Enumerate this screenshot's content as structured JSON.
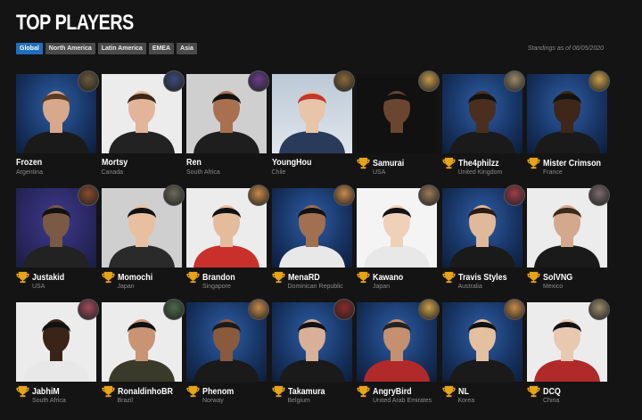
{
  "title": "TOP PLAYERS",
  "tabs": [
    "Global",
    "North America",
    "Latin America",
    "EMEA",
    "Asia"
  ],
  "active_tab": "Global",
  "standings": "Standings as of 06/05/2020",
  "colors": {
    "accent": "#1f6fbd",
    "background": "#141414",
    "trophy": "#e8a317",
    "muted": "#8a8a8a"
  },
  "players": [
    {
      "name": "Frozen",
      "country": "Argentina",
      "trophy": false,
      "bg": "bg-blue",
      "icon": "character-icon",
      "iconColor": "#6b5a3a"
    },
    {
      "name": "Mortsy",
      "country": "Canada",
      "trophy": false,
      "bg": "bg-white",
      "icon": "character-icon",
      "iconColor": "#3b4a7a"
    },
    {
      "name": "Ren",
      "country": "South Africa",
      "trophy": false,
      "bg": "bg-gray",
      "icon": "character-icon",
      "iconColor": "#6a3d8a"
    },
    {
      "name": "YoungHou",
      "country": "Chile",
      "trophy": false,
      "bg": "bg-sky",
      "icon": "character-icon",
      "iconColor": "#8a6a3a"
    },
    {
      "name": "Samurai",
      "country": "USA",
      "trophy": true,
      "bg": "bg-dark",
      "icon": "character-icon",
      "iconColor": "#c49a4a"
    },
    {
      "name": "The4philzz",
      "country": "United Kingdom",
      "trophy": true,
      "bg": "bg-blue",
      "icon": "character-icon",
      "iconColor": "#9a8a6a"
    },
    {
      "name": "Mister Crimson",
      "country": "France",
      "trophy": true,
      "bg": "bg-blue",
      "icon": "character-icon",
      "iconColor": "#c9a04a"
    },
    {
      "name": "Justakid",
      "country": "USA",
      "trophy": true,
      "bg": "bg-purple",
      "icon": "character-icon",
      "iconColor": "#8a4a2a"
    },
    {
      "name": "Momochi",
      "country": "Japan",
      "trophy": true,
      "bg": "bg-gray",
      "icon": "character-icon",
      "iconColor": "#6a6a5a"
    },
    {
      "name": "Brandon",
      "country": "Singapore",
      "trophy": true,
      "bg": "bg-white",
      "icon": "character-icon",
      "iconColor": "#c98a4a"
    },
    {
      "name": "MenaRD",
      "country": "Dominican Republic",
      "trophy": true,
      "bg": "bg-blue",
      "icon": "character-icon",
      "iconColor": "#c98a4a"
    },
    {
      "name": "Kawano",
      "country": "Japan",
      "trophy": true,
      "bg": "bg-light",
      "icon": "character-icon",
      "iconColor": "#9a7a5a"
    },
    {
      "name": "Travis Styles",
      "country": "Australia",
      "trophy": true,
      "bg": "bg-blue",
      "icon": "character-icon",
      "iconColor": "#a03a4a"
    },
    {
      "name": "SolVNG",
      "country": "Mexico",
      "trophy": true,
      "bg": "bg-white",
      "icon": "character-icon",
      "iconColor": "#7a6a6a"
    },
    {
      "name": "JabhiM",
      "country": "South Africa",
      "trophy": true,
      "bg": "bg-white",
      "icon": "character-icon",
      "iconColor": "#a04a5a"
    },
    {
      "name": "RonaldinhoBR",
      "country": "Brazil",
      "trophy": true,
      "bg": "bg-white",
      "icon": "character-icon",
      "iconColor": "#4a6a4a"
    },
    {
      "name": "Phenom",
      "country": "Norway",
      "trophy": true,
      "bg": "bg-blue",
      "icon": "character-icon",
      "iconColor": "#c98a4a"
    },
    {
      "name": "Takamura",
      "country": "Belgium",
      "trophy": true,
      "bg": "bg-blue",
      "icon": "character-icon",
      "iconColor": "#8a2a2a"
    },
    {
      "name": "AngryBird",
      "country": "United Arab Emirates",
      "trophy": true,
      "bg": "bg-blue",
      "icon": "character-icon",
      "iconColor": "#c9a04a"
    },
    {
      "name": "NL",
      "country": "Korea",
      "trophy": true,
      "bg": "bg-blue",
      "icon": "character-icon",
      "iconColor": "#c98a4a"
    },
    {
      "name": "DCQ",
      "country": "China",
      "trophy": true,
      "bg": "bg-white",
      "icon": "character-icon",
      "iconColor": "#9a8a6a"
    }
  ]
}
